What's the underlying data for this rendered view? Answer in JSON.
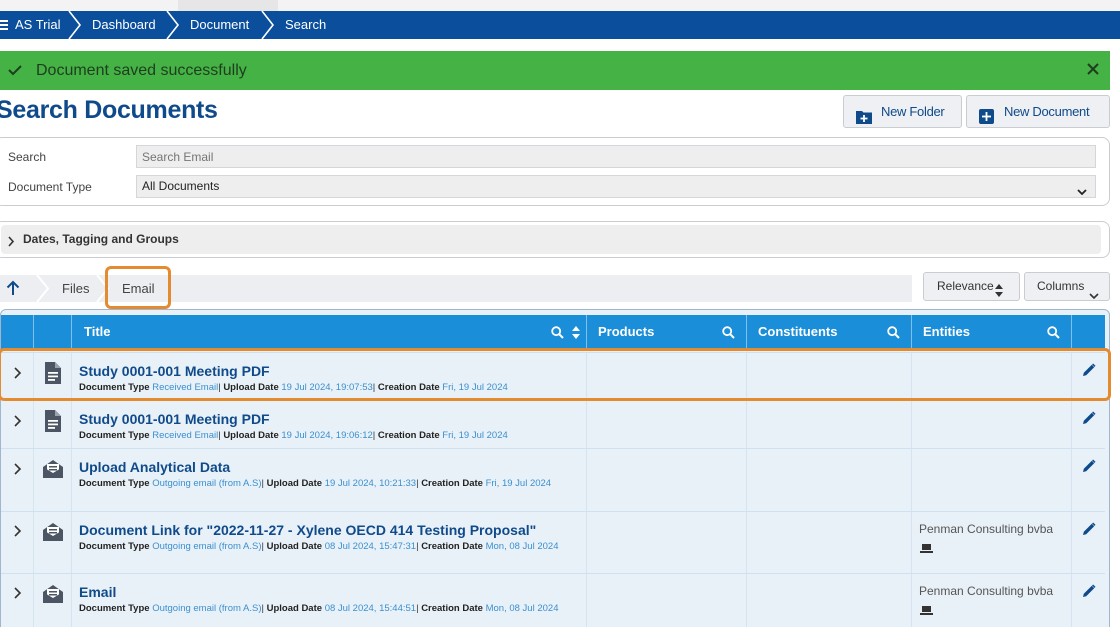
{
  "breadcrumb": {
    "items": [
      "AS Trial",
      "Dashboard",
      "Document",
      "Search"
    ]
  },
  "alert": {
    "message": "Document saved successfully",
    "color": "#45b245"
  },
  "header": {
    "title": "Search Documents",
    "new_folder_label": "New Folder",
    "new_document_label": "New Document"
  },
  "search_form": {
    "search_label": "Search",
    "search_placeholder": "Search Email",
    "doc_type_label": "Document Type",
    "doc_type_value": "All Documents"
  },
  "filters": {
    "collapsible_label": "Dates, Tagging and Groups"
  },
  "path": {
    "files_label": "Files",
    "email_label": "Email"
  },
  "sort": {
    "relevance_label": "Relevance",
    "columns_label": "Columns"
  },
  "table": {
    "columns": [
      "Title",
      "Products",
      "Constituents",
      "Entities"
    ],
    "meta_labels": {
      "doc_type": "Document Type",
      "upload_date": "Upload Date",
      "creation_date": "Creation Date"
    },
    "rows": [
      {
        "icon": "document-icon",
        "title": "Study 0001-001 Meeting PDF",
        "doc_type": "Received Email",
        "upload_date": "19 Jul 2024, 19:07:53",
        "creation_date": "Fri, 19 Jul 2024",
        "entity": ""
      },
      {
        "icon": "document-icon",
        "title": "Study 0001-001 Meeting PDF",
        "doc_type": "Received Email",
        "upload_date": "19 Jul 2024, 19:06:12",
        "creation_date": "Fri, 19 Jul 2024",
        "entity": ""
      },
      {
        "icon": "email-open-icon",
        "title": "Upload Analytical Data",
        "doc_type": "Outgoing email (from A.S)",
        "upload_date": "19 Jul 2024, 10:21:33",
        "creation_date": "Fri, 19 Jul 2024",
        "entity": ""
      },
      {
        "icon": "email-open-icon",
        "title": "Document Link for \"2022-11-27 - Xylene OECD 414 Testing Proposal\"",
        "doc_type": "Outgoing email (from A.S)",
        "upload_date": "08 Jul 2024, 15:47:31",
        "creation_date": "Mon, 08 Jul 2024",
        "entity": "Penman Consulting bvba"
      },
      {
        "icon": "email-open-icon",
        "title": "Email",
        "doc_type": "Outgoing email (from A.S)",
        "upload_date": "08 Jul 2024, 15:44:51",
        "creation_date": "Mon, 08 Jul 2024",
        "entity": "Penman Consulting bvba"
      }
    ]
  },
  "colors": {
    "brand_navy": "#0b4f9c",
    "header_blue": "#1a8ed9",
    "highlight_orange": "#e58b2f",
    "link_blue": "#3a8fd0"
  }
}
